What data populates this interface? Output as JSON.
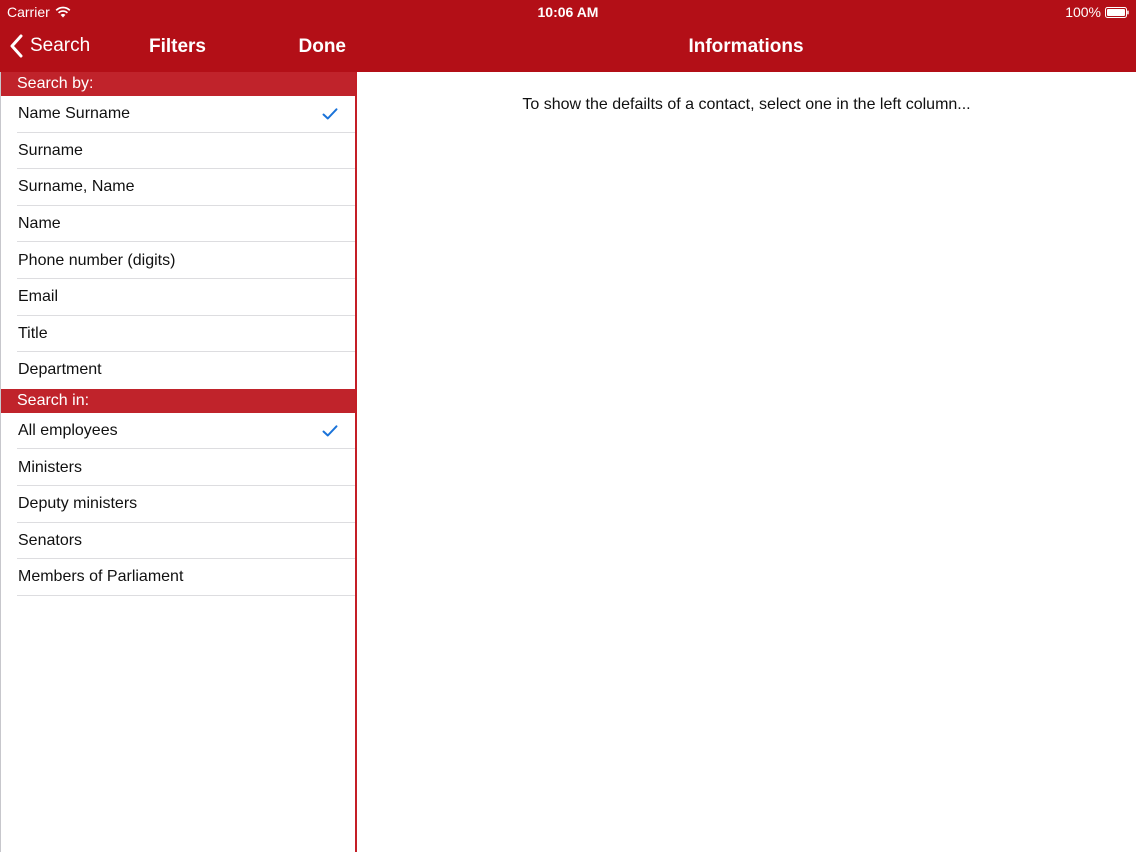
{
  "status_bar": {
    "carrier": "Carrier",
    "time": "10:06 AM",
    "battery": "100%"
  },
  "colors": {
    "accent": "#b30f17",
    "section_header": "#c0232b",
    "checkmark": "#1a73d9"
  },
  "left_nav": {
    "back_label": "Search",
    "title": "Filters",
    "done_label": "Done"
  },
  "right_nav": {
    "title": "Informations"
  },
  "search_by": {
    "header": "Search by:",
    "items": [
      {
        "label": "Name Surname",
        "checked": true
      },
      {
        "label": "Surname",
        "checked": false
      },
      {
        "label": "Surname, Name",
        "checked": false
      },
      {
        "label": "Name",
        "checked": false
      },
      {
        "label": "Phone number (digits)",
        "checked": false
      },
      {
        "label": "Email",
        "checked": false
      },
      {
        "label": "Title",
        "checked": false
      },
      {
        "label": "Department",
        "checked": false
      }
    ]
  },
  "search_in": {
    "header": "Search in:",
    "items": [
      {
        "label": "All employees",
        "checked": true
      },
      {
        "label": "Ministers",
        "checked": false
      },
      {
        "label": "Deputy ministers",
        "checked": false
      },
      {
        "label": "Senators",
        "checked": false
      },
      {
        "label": "Members of Parliament",
        "checked": false
      }
    ]
  },
  "detail": {
    "message": "To show the defailts of a contact, select one in the left column..."
  }
}
